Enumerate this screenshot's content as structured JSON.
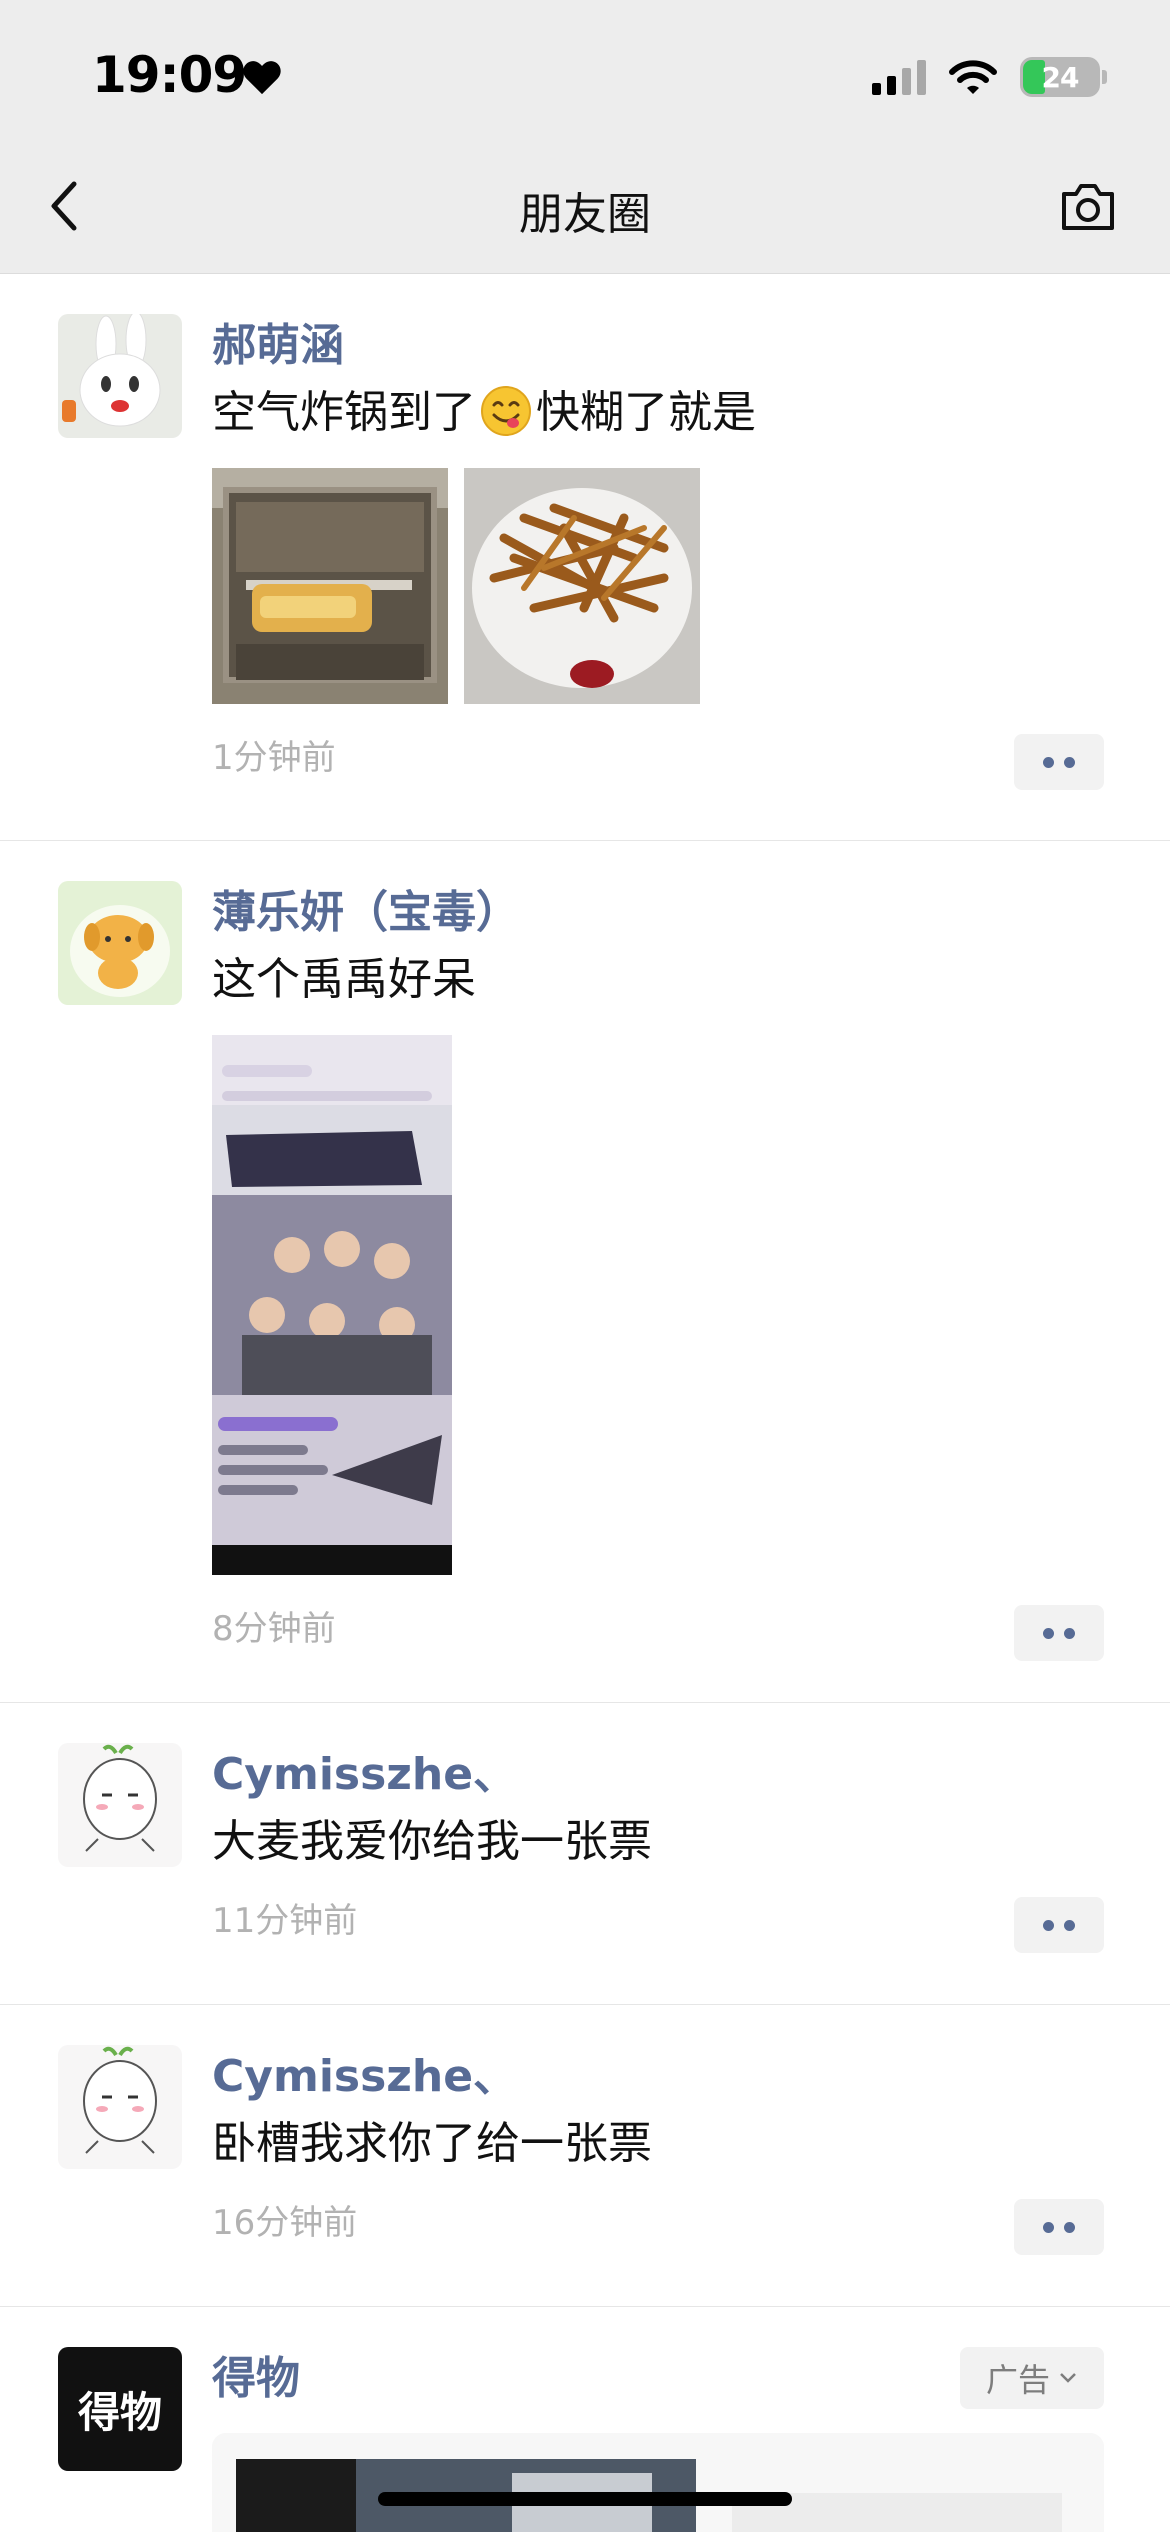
{
  "status_bar": {
    "time": "19:09",
    "battery": "24"
  },
  "nav": {
    "title": "朋友圈"
  },
  "posts": [
    {
      "name": "郝萌涵",
      "text_before_emoji": "空气炸锅到了",
      "text_after_emoji": "快糊了就是",
      "time": "1分钟前"
    },
    {
      "name": "薄乐妍（宝毒）",
      "text": "这个禹禹好呆",
      "time": "8分钟前"
    },
    {
      "name": "Cymisszhe、",
      "text": "大麦我爱你给我一张票",
      "time": "11分钟前"
    },
    {
      "name": "Cymisszhe、",
      "text": "卧槽我求你了给一张票",
      "time": "16分钟前"
    }
  ],
  "ad": {
    "name": "得物",
    "logo_text": "得物",
    "tag": "广告"
  },
  "colors": {
    "name_link": "#576b95",
    "top_bar": "#ededed",
    "time_gray": "#b2b2b2"
  }
}
